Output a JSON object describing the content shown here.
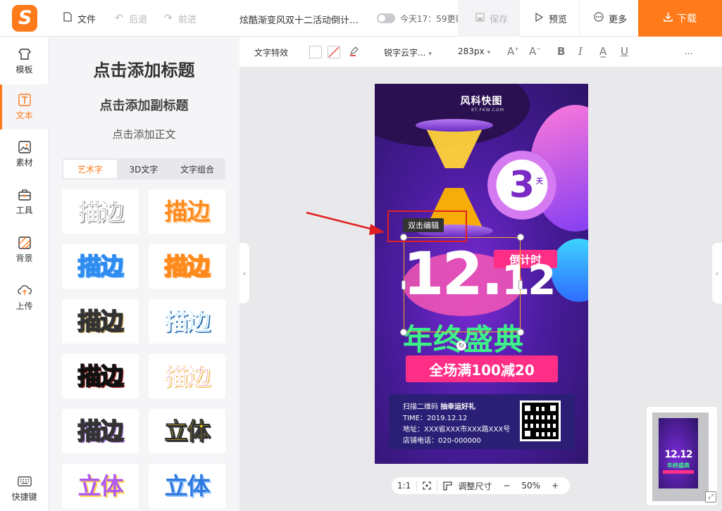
{
  "topbar": {
    "file": "文件",
    "undo": "后退",
    "redo": "前进",
    "doc_title": "炫酷渐变风双十二活动倒计时...",
    "update_time": "今天17：59更新",
    "save": "保存",
    "preview": "预览",
    "more": "更多",
    "download": "下载"
  },
  "rail": {
    "items": [
      {
        "label": "模板",
        "icon": "template-icon"
      },
      {
        "label": "文本",
        "icon": "text-icon",
        "active": true
      },
      {
        "label": "素材",
        "icon": "material-icon"
      },
      {
        "label": "工具",
        "icon": "toolbox-icon"
      },
      {
        "label": "背景",
        "icon": "background-icon"
      },
      {
        "label": "上传",
        "icon": "upload-icon"
      }
    ],
    "shortcut": "快捷键"
  },
  "panel": {
    "add_title": "点击添加标题",
    "add_subtitle": "点击添加副标题",
    "add_body": "点击添加正文",
    "tabs": [
      "艺术字",
      "3D文字",
      "文字组合"
    ],
    "samples": [
      "描边",
      "描边",
      "描边",
      "描边",
      "描边",
      "描边",
      "描边",
      "描边",
      "描边",
      "立体",
      "立体",
      "立体"
    ]
  },
  "toolbar": {
    "text_effect": "文字特效",
    "font": "锐字云字...",
    "font_size": "283px",
    "more": "..."
  },
  "poster": {
    "brand": "风科快图",
    "brand_url": "KT.FKW.COM",
    "clock_number": "3",
    "clock_unit": "天",
    "countdown": "倒计时",
    "date_main": "12.",
    "date_tail": "12",
    "slogan": "年终盛典",
    "promo": "全场满100减20",
    "info": {
      "scan": "扫描二维码",
      "scan_bold": "抽幸运好礼",
      "time": "TIME：2019.12.12",
      "address": "地址：XXX省XXX市XXX路XXX号",
      "phone": "店铺电话：020-000000"
    },
    "mini_date": "12.12",
    "mini_slogan": "年终盛典"
  },
  "canvas": {
    "edit_hint": "双击编辑"
  },
  "zoombar": {
    "ratio": "1:1",
    "resize": "调整尺寸",
    "zoom": "50%",
    "minus": "−",
    "plus": "+"
  },
  "colors": {
    "accent": "#ff7a1a",
    "poster_pink": "#ff2f87",
    "poster_green": "#3ef28a",
    "callout_red": "#e02020"
  }
}
